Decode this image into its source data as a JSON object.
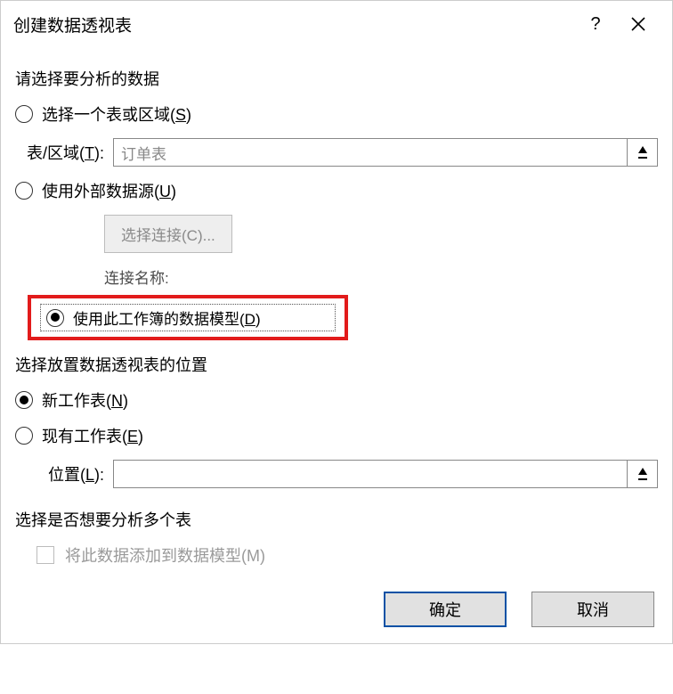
{
  "title": "创建数据透视表",
  "section1": {
    "header": "请选择要分析的数据",
    "opt_select_range_pre": "选择一个表或区域(",
    "opt_select_range_key": "S",
    "opt_select_range_post": ")",
    "table_label_pre": "表/区域(",
    "table_label_key": "T",
    "table_label_post": "):",
    "table_value": "订单表",
    "opt_external_pre": "使用外部数据源(",
    "opt_external_key": "U",
    "opt_external_post": ")",
    "choose_conn_btn": "选择连接(C)...",
    "conn_name_label": "连接名称:",
    "opt_data_model_pre": "使用此工作簿的数据模型(",
    "opt_data_model_key": "D",
    "opt_data_model_post": ")"
  },
  "section2": {
    "header": "选择放置数据透视表的位置",
    "opt_new_sheet_pre": "新工作表(",
    "opt_new_sheet_key": "N",
    "opt_new_sheet_post": ")",
    "opt_existing_pre": "现有工作表(",
    "opt_existing_key": "E",
    "opt_existing_post": ")",
    "location_label_pre": "位置(",
    "location_label_key": "L",
    "location_label_post": "):",
    "location_value": ""
  },
  "section3": {
    "header": "选择是否想要分析多个表",
    "checkbox_label": "将此数据添加到数据模型(M)"
  },
  "buttons": {
    "ok": "确定",
    "cancel": "取消"
  }
}
